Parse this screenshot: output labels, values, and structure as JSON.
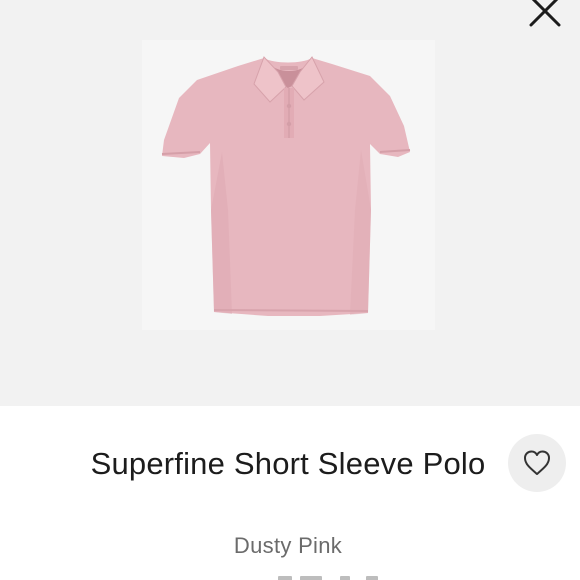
{
  "product": {
    "name": "Superfine Short Sleeve Polo",
    "color_name": "Dusty Pink",
    "swatch_color": "#e7b7bf"
  },
  "icons": {
    "close": "close-icon",
    "favorite": "heart-outline-icon"
  },
  "theme": {
    "hero_background": "#f2f2f2",
    "favorite_background": "#eeeeee",
    "title_color": "#1c1c1c",
    "subtitle_color": "#6b6b6b"
  }
}
